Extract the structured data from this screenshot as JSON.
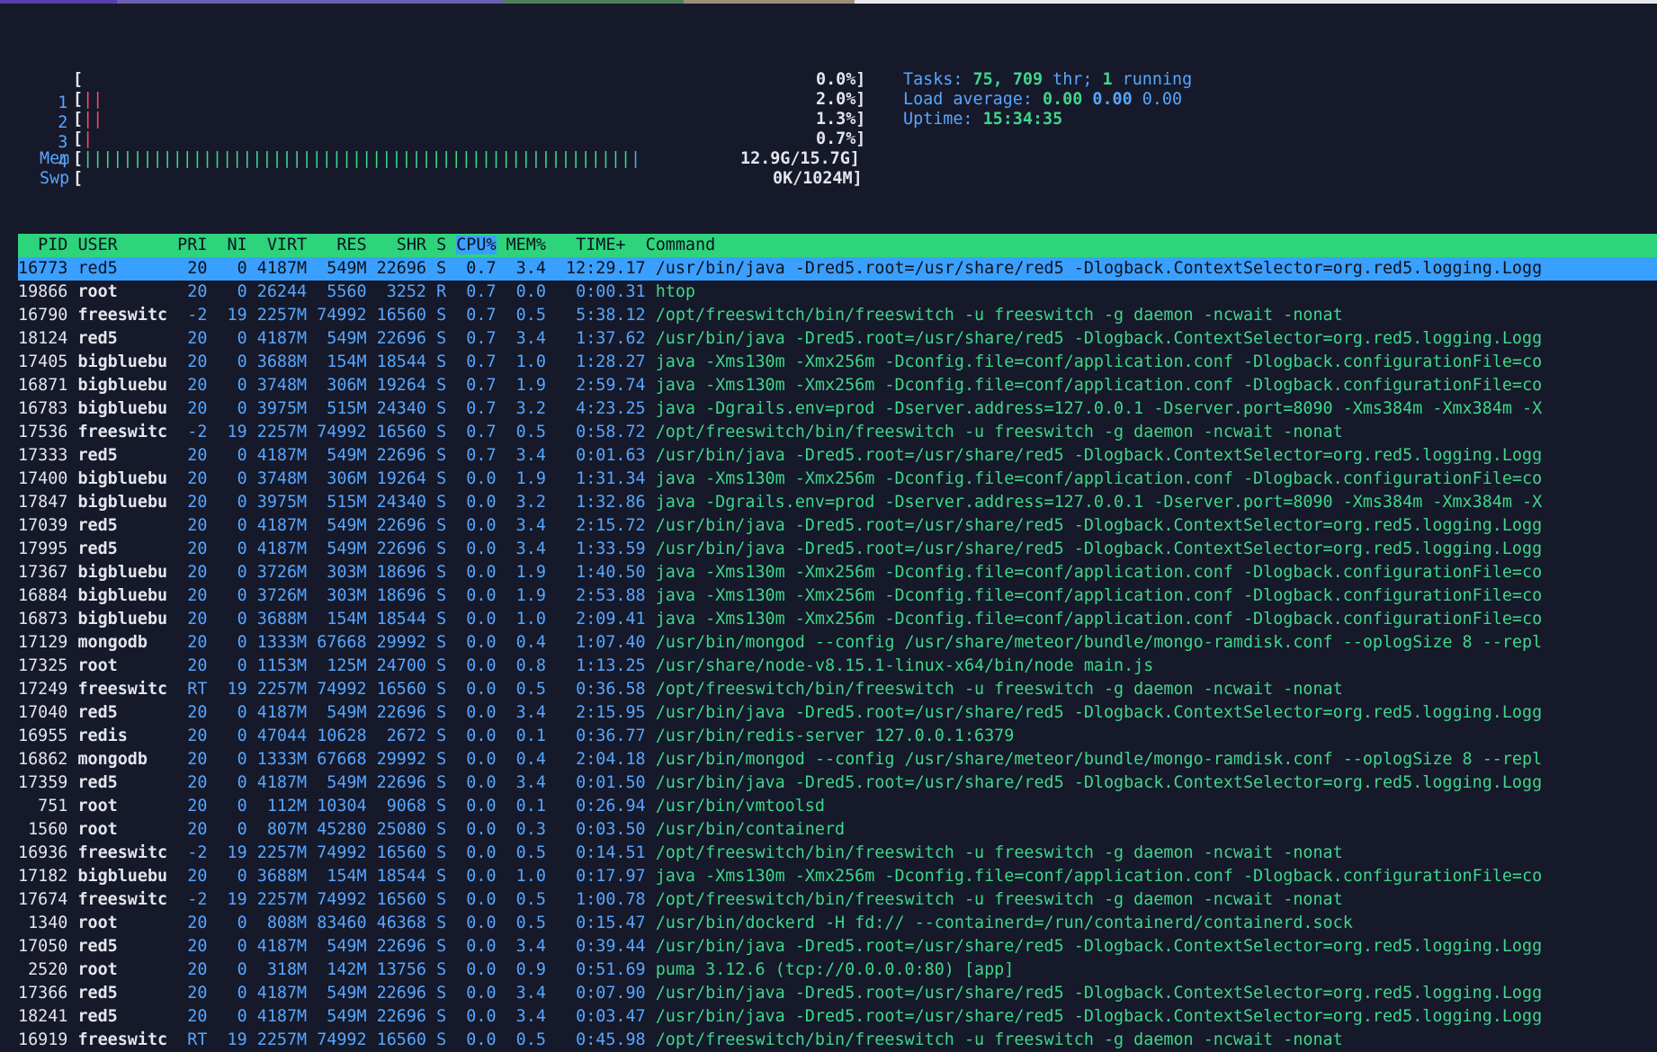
{
  "cpu_meters": [
    {
      "id": "1",
      "bars": "",
      "percent": "0.0%"
    },
    {
      "id": "2",
      "bars": "||",
      "percent": "2.0%"
    },
    {
      "id": "3",
      "bars": "||",
      "percent": "1.3%"
    },
    {
      "id": "4",
      "bars": "|",
      "percent": "0.7%"
    }
  ],
  "mem": {
    "label": "Mem",
    "value": "12.9G/15.7G"
  },
  "swp": {
    "label": "Swp",
    "value": "0K/1024M"
  },
  "tasks": {
    "label": "Tasks:",
    "count": "75",
    "threads": "709",
    "thr_label": "thr;",
    "running": "1",
    "running_label": "running"
  },
  "load": {
    "label": "Load average:",
    "one": "0.00",
    "five": "0.00",
    "fifteen": "0.00"
  },
  "uptime": {
    "label": "Uptime:",
    "value": "15:34:35"
  },
  "columns": {
    "pid": "PID",
    "user": "USER",
    "pri": "PRI",
    "ni": "NI",
    "virt": "VIRT",
    "res": "RES",
    "shr": "SHR",
    "s": "S",
    "cpu": "CPU%",
    "mem": "MEM%",
    "time": "TIME+",
    "command": "Command"
  },
  "processes": [
    {
      "pid": "16773",
      "user": "red5",
      "pri": "20",
      "ni": "0",
      "virt": "4187M",
      "res": "549M",
      "shr": "22696",
      "s": "S",
      "cpu": "0.7",
      "mem": "3.4",
      "time": "12:29.17",
      "command": "/usr/bin/java -Dred5.root=/usr/share/red5 -Dlogback.ContextSelector=org.red5.logging.Logg"
    },
    {
      "pid": "19866",
      "user": "root",
      "pri": "20",
      "ni": "0",
      "virt": "26244",
      "res": "5560",
      "shr": "3252",
      "s": "R",
      "cpu": "0.7",
      "mem": "0.0",
      "time": "0:00.31",
      "command": "htop"
    },
    {
      "pid": "16790",
      "user": "freeswitc",
      "pri": "-2",
      "ni": "19",
      "virt": "2257M",
      "res": "74992",
      "shr": "16560",
      "s": "S",
      "cpu": "0.7",
      "mem": "0.5",
      "time": "5:38.12",
      "command": "/opt/freeswitch/bin/freeswitch -u freeswitch -g daemon -ncwait -nonat"
    },
    {
      "pid": "18124",
      "user": "red5",
      "pri": "20",
      "ni": "0",
      "virt": "4187M",
      "res": "549M",
      "shr": "22696",
      "s": "S",
      "cpu": "0.7",
      "mem": "3.4",
      "time": "1:37.62",
      "command": "/usr/bin/java -Dred5.root=/usr/share/red5 -Dlogback.ContextSelector=org.red5.logging.Logg"
    },
    {
      "pid": "17405",
      "user": "bigbluebu",
      "pri": "20",
      "ni": "0",
      "virt": "3688M",
      "res": "154M",
      "shr": "18544",
      "s": "S",
      "cpu": "0.7",
      "mem": "1.0",
      "time": "1:28.27",
      "command": "java -Xms130m -Xmx256m -Dconfig.file=conf/application.conf -Dlogback.configurationFile=co"
    },
    {
      "pid": "16871",
      "user": "bigbluebu",
      "pri": "20",
      "ni": "0",
      "virt": "3748M",
      "res": "306M",
      "shr": "19264",
      "s": "S",
      "cpu": "0.7",
      "mem": "1.9",
      "time": "2:59.74",
      "command": "java -Xms130m -Xmx256m -Dconfig.file=conf/application.conf -Dlogback.configurationFile=co"
    },
    {
      "pid": "16783",
      "user": "bigbluebu",
      "pri": "20",
      "ni": "0",
      "virt": "3975M",
      "res": "515M",
      "shr": "24340",
      "s": "S",
      "cpu": "0.7",
      "mem": "3.2",
      "time": "4:23.25",
      "command": "java -Dgrails.env=prod -Dserver.address=127.0.0.1 -Dserver.port=8090 -Xms384m -Xmx384m -X"
    },
    {
      "pid": "17536",
      "user": "freeswitc",
      "pri": "-2",
      "ni": "19",
      "virt": "2257M",
      "res": "74992",
      "shr": "16560",
      "s": "S",
      "cpu": "0.7",
      "mem": "0.5",
      "time": "0:58.72",
      "command": "/opt/freeswitch/bin/freeswitch -u freeswitch -g daemon -ncwait -nonat"
    },
    {
      "pid": "17333",
      "user": "red5",
      "pri": "20",
      "ni": "0",
      "virt": "4187M",
      "res": "549M",
      "shr": "22696",
      "s": "S",
      "cpu": "0.7",
      "mem": "3.4",
      "time": "0:01.63",
      "command": "/usr/bin/java -Dred5.root=/usr/share/red5 -Dlogback.ContextSelector=org.red5.logging.Logg"
    },
    {
      "pid": "17400",
      "user": "bigbluebu",
      "pri": "20",
      "ni": "0",
      "virt": "3748M",
      "res": "306M",
      "shr": "19264",
      "s": "S",
      "cpu": "0.0",
      "mem": "1.9",
      "time": "1:31.34",
      "command": "java -Xms130m -Xmx256m -Dconfig.file=conf/application.conf -Dlogback.configurationFile=co"
    },
    {
      "pid": "17847",
      "user": "bigbluebu",
      "pri": "20",
      "ni": "0",
      "virt": "3975M",
      "res": "515M",
      "shr": "24340",
      "s": "S",
      "cpu": "0.0",
      "mem": "3.2",
      "time": "1:32.86",
      "command": "java -Dgrails.env=prod -Dserver.address=127.0.0.1 -Dserver.port=8090 -Xms384m -Xmx384m -X"
    },
    {
      "pid": "17039",
      "user": "red5",
      "pri": "20",
      "ni": "0",
      "virt": "4187M",
      "res": "549M",
      "shr": "22696",
      "s": "S",
      "cpu": "0.0",
      "mem": "3.4",
      "time": "2:15.72",
      "command": "/usr/bin/java -Dred5.root=/usr/share/red5 -Dlogback.ContextSelector=org.red5.logging.Logg"
    },
    {
      "pid": "17995",
      "user": "red5",
      "pri": "20",
      "ni": "0",
      "virt": "4187M",
      "res": "549M",
      "shr": "22696",
      "s": "S",
      "cpu": "0.0",
      "mem": "3.4",
      "time": "1:33.59",
      "command": "/usr/bin/java -Dred5.root=/usr/share/red5 -Dlogback.ContextSelector=org.red5.logging.Logg"
    },
    {
      "pid": "17367",
      "user": "bigbluebu",
      "pri": "20",
      "ni": "0",
      "virt": "3726M",
      "res": "303M",
      "shr": "18696",
      "s": "S",
      "cpu": "0.0",
      "mem": "1.9",
      "time": "1:40.50",
      "command": "java -Xms130m -Xmx256m -Dconfig.file=conf/application.conf -Dlogback.configurationFile=co"
    },
    {
      "pid": "16884",
      "user": "bigbluebu",
      "pri": "20",
      "ni": "0",
      "virt": "3726M",
      "res": "303M",
      "shr": "18696",
      "s": "S",
      "cpu": "0.0",
      "mem": "1.9",
      "time": "2:53.88",
      "command": "java -Xms130m -Xmx256m -Dconfig.file=conf/application.conf -Dlogback.configurationFile=co"
    },
    {
      "pid": "16873",
      "user": "bigbluebu",
      "pri": "20",
      "ni": "0",
      "virt": "3688M",
      "res": "154M",
      "shr": "18544",
      "s": "S",
      "cpu": "0.0",
      "mem": "1.0",
      "time": "2:09.41",
      "command": "java -Xms130m -Xmx256m -Dconfig.file=conf/application.conf -Dlogback.configurationFile=co"
    },
    {
      "pid": "17129",
      "user": "mongodb",
      "pri": "20",
      "ni": "0",
      "virt": "1333M",
      "res": "67668",
      "shr": "29992",
      "s": "S",
      "cpu": "0.0",
      "mem": "0.4",
      "time": "1:07.40",
      "command": "/usr/bin/mongod --config /usr/share/meteor/bundle/mongo-ramdisk.conf --oplogSize 8 --repl"
    },
    {
      "pid": "17325",
      "user": "root",
      "pri": "20",
      "ni": "0",
      "virt": "1153M",
      "res": "125M",
      "shr": "24700",
      "s": "S",
      "cpu": "0.0",
      "mem": "0.8",
      "time": "1:13.25",
      "command": "/usr/share/node-v8.15.1-linux-x64/bin/node main.js"
    },
    {
      "pid": "17249",
      "user": "freeswitc",
      "pri": "RT",
      "ni": "19",
      "virt": "2257M",
      "res": "74992",
      "shr": "16560",
      "s": "S",
      "cpu": "0.0",
      "mem": "0.5",
      "time": "0:36.58",
      "command": "/opt/freeswitch/bin/freeswitch -u freeswitch -g daemon -ncwait -nonat"
    },
    {
      "pid": "17040",
      "user": "red5",
      "pri": "20",
      "ni": "0",
      "virt": "4187M",
      "res": "549M",
      "shr": "22696",
      "s": "S",
      "cpu": "0.0",
      "mem": "3.4",
      "time": "2:15.95",
      "command": "/usr/bin/java -Dred5.root=/usr/share/red5 -Dlogback.ContextSelector=org.red5.logging.Logg"
    },
    {
      "pid": "16955",
      "user": "redis",
      "pri": "20",
      "ni": "0",
      "virt": "47044",
      "res": "10628",
      "shr": "2672",
      "s": "S",
      "cpu": "0.0",
      "mem": "0.1",
      "time": "0:36.77",
      "command": "/usr/bin/redis-server 127.0.0.1:6379"
    },
    {
      "pid": "16862",
      "user": "mongodb",
      "pri": "20",
      "ni": "0",
      "virt": "1333M",
      "res": "67668",
      "shr": "29992",
      "s": "S",
      "cpu": "0.0",
      "mem": "0.4",
      "time": "2:04.18",
      "command": "/usr/bin/mongod --config /usr/share/meteor/bundle/mongo-ramdisk.conf --oplogSize 8 --repl"
    },
    {
      "pid": "17359",
      "user": "red5",
      "pri": "20",
      "ni": "0",
      "virt": "4187M",
      "res": "549M",
      "shr": "22696",
      "s": "S",
      "cpu": "0.0",
      "mem": "3.4",
      "time": "0:01.50",
      "command": "/usr/bin/java -Dred5.root=/usr/share/red5 -Dlogback.ContextSelector=org.red5.logging.Logg"
    },
    {
      "pid": "751",
      "user": "root",
      "pri": "20",
      "ni": "0",
      "virt": "112M",
      "res": "10304",
      "shr": "9068",
      "s": "S",
      "cpu": "0.0",
      "mem": "0.1",
      "time": "0:26.94",
      "command": "/usr/bin/vmtoolsd"
    },
    {
      "pid": "1560",
      "user": "root",
      "pri": "20",
      "ni": "0",
      "virt": "807M",
      "res": "45280",
      "shr": "25080",
      "s": "S",
      "cpu": "0.0",
      "mem": "0.3",
      "time": "0:03.50",
      "command": "/usr/bin/containerd"
    },
    {
      "pid": "16936",
      "user": "freeswitc",
      "pri": "-2",
      "ni": "19",
      "virt": "2257M",
      "res": "74992",
      "shr": "16560",
      "s": "S",
      "cpu": "0.0",
      "mem": "0.5",
      "time": "0:14.51",
      "command": "/opt/freeswitch/bin/freeswitch -u freeswitch -g daemon -ncwait -nonat"
    },
    {
      "pid": "17182",
      "user": "bigbluebu",
      "pri": "20",
      "ni": "0",
      "virt": "3688M",
      "res": "154M",
      "shr": "18544",
      "s": "S",
      "cpu": "0.0",
      "mem": "1.0",
      "time": "0:17.97",
      "command": "java -Xms130m -Xmx256m -Dconfig.file=conf/application.conf -Dlogback.configurationFile=co"
    },
    {
      "pid": "17674",
      "user": "freeswitc",
      "pri": "-2",
      "ni": "19",
      "virt": "2257M",
      "res": "74992",
      "shr": "16560",
      "s": "S",
      "cpu": "0.0",
      "mem": "0.5",
      "time": "1:00.78",
      "command": "/opt/freeswitch/bin/freeswitch -u freeswitch -g daemon -ncwait -nonat"
    },
    {
      "pid": "1340",
      "user": "root",
      "pri": "20",
      "ni": "0",
      "virt": "808M",
      "res": "83460",
      "shr": "46368",
      "s": "S",
      "cpu": "0.0",
      "mem": "0.5",
      "time": "0:15.47",
      "command": "/usr/bin/dockerd -H fd:// --containerd=/run/containerd/containerd.sock"
    },
    {
      "pid": "17050",
      "user": "red5",
      "pri": "20",
      "ni": "0",
      "virt": "4187M",
      "res": "549M",
      "shr": "22696",
      "s": "S",
      "cpu": "0.0",
      "mem": "3.4",
      "time": "0:39.44",
      "command": "/usr/bin/java -Dred5.root=/usr/share/red5 -Dlogback.ContextSelector=org.red5.logging.Logg"
    },
    {
      "pid": "2520",
      "user": "root",
      "pri": "20",
      "ni": "0",
      "virt": "318M",
      "res": "142M",
      "shr": "13756",
      "s": "S",
      "cpu": "0.0",
      "mem": "0.9",
      "time": "0:51.69",
      "command": "puma 3.12.6 (tcp://0.0.0.0:80) [app]"
    },
    {
      "pid": "17366",
      "user": "red5",
      "pri": "20",
      "ni": "0",
      "virt": "4187M",
      "res": "549M",
      "shr": "22696",
      "s": "S",
      "cpu": "0.0",
      "mem": "3.4",
      "time": "0:07.90",
      "command": "/usr/bin/java -Dred5.root=/usr/share/red5 -Dlogback.ContextSelector=org.red5.logging.Logg"
    },
    {
      "pid": "18241",
      "user": "red5",
      "pri": "20",
      "ni": "0",
      "virt": "4187M",
      "res": "549M",
      "shr": "22696",
      "s": "S",
      "cpu": "0.0",
      "mem": "3.4",
      "time": "0:03.47",
      "command": "/usr/bin/java -Dred5.root=/usr/share/red5 -Dlogback.ContextSelector=org.red5.logging.Logg"
    },
    {
      "pid": "16919",
      "user": "freeswitc",
      "pri": "RT",
      "ni": "19",
      "virt": "2257M",
      "res": "74992",
      "shr": "16560",
      "s": "S",
      "cpu": "0.0",
      "mem": "0.5",
      "time": "0:45.98",
      "command": "/opt/freeswitch/bin/freeswitch -u freeswitch -g daemon -ncwait -nonat"
    }
  ],
  "selected_index": 0,
  "colors": {
    "background": "#15192a",
    "header": "#2ed47c",
    "selection": "#3aa0ff",
    "text_green": "#3fd68a",
    "text_blue": "#57a6ff",
    "bar_red": "#ff4d5e"
  }
}
